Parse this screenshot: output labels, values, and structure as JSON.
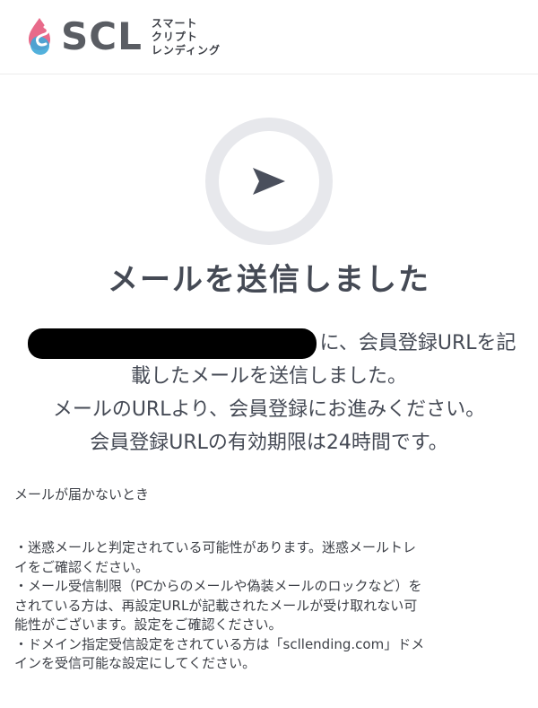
{
  "header": {
    "logo_text": "SCL",
    "logo_sub": [
      "スマート",
      "クリプト",
      "レンディング"
    ]
  },
  "icon": {
    "name": "send-icon",
    "color": "#4a4f5c"
  },
  "title": "メールを送信しました",
  "message": {
    "line1_prefix": "",
    "line1_suffix": "に、会員登録URLを記",
    "line2": "載したメールを送信しました。",
    "line3": "メールのURLより、会員登録にお進みください。",
    "line4": "会員登録URLの有効期限は24時間です。"
  },
  "notes": {
    "heading": "メールが届かないとき",
    "lines": [
      "・迷惑メールと判定されている可能性があります。迷惑メールトレ",
      "イをご確認ください。",
      "・メール受信制限（PCからのメールや偽装メールのロックなど）を",
      "されている方は、再設定URLが記載されたメールが受け取れない可",
      "能性がございます。設定をご確認ください。",
      "・ドメイン指定受信設定をされている方は「scllending.com」ドメ",
      "インを受信可能な設定にしてください。"
    ]
  },
  "colors": {
    "text": "#454a55",
    "logo_pink": "#e86a8a",
    "logo_blue": "#3fa8d8",
    "circle": "#e7e8ec"
  }
}
